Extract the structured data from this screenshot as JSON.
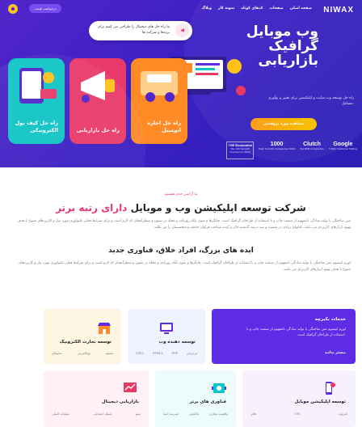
{
  "header": {
    "logo": "NIWAX",
    "nav": [
      "صفحه اصلی",
      "صفحات",
      "کدهای کوتاه",
      "نمونه کار",
      "وبلاگ"
    ],
    "request_button": "درخواست قیمت"
  },
  "hero": {
    "callout_text": "ما راه حل های دیجیتال را طراحی می کنیم برای برندها و شرکت ها",
    "title": "وب موبایل گرافیک بازاریابی",
    "subtitle": "راه حل توسعه وب سایت و اپلیکیشن برای تغییر و نوآوری مشاغل.",
    "cta": "مشاهده مورد پژوهشی",
    "cards": [
      {
        "label": "راه حل اجاره اتومبیل"
      },
      {
        "label": "راه حل بازاریابی"
      },
      {
        "label": "راه حل کیف پول الکترونیکی"
      }
    ],
    "badges": [
      {
        "big": "Google",
        "small": "5 Star Customer Rating"
      },
      {
        "big": "Clutch",
        "small": "Top B2B Companies"
      },
      {
        "big": "1000",
        "small": "High Growth Companies 2020"
      },
      {
        "big": "THE Economist",
        "small": "Top 100 Growth Champions 2020"
      }
    ],
    "colors": {
      "card_1": "#ff8a26",
      "card_2": "#e83a68",
      "card_3": "#0fc4c4"
    }
  },
  "intro": {
    "kicker": "ما آژانس جدی هستیم",
    "title_main": "شرکت توسعه اپلیکیشن وب و موبایل",
    "title_accent": "دارای رتبه برتر",
    "paragraph_1": "متن ساختگی با تولید سادگی نامفهوم از صنعت چاپ و با استفاده از طراحان گرافیک است. چاپگرها و متون بلکه روزنامه و مجله در ستون و سطرآنچنان که لازم است و برای شرایط فعلی تکنولوژی مورد نیاز و کاربردهای متنوع با هدف بهبود ابزارهای کاربردی می باشد. کتابهای زیادی در شصت و سه درصد گذشته حال و آینده شناخت فراوان جامعه و متخصصان را می طلبد.",
    "heading_2": "ایده های بزرگ، افراد خلاق، فناوری جدید",
    "paragraph_2": "لورم ایپسوم متن ساختگی با تولید سادگی نامفهوم از صنعت چاپ و با استفاده از طراحان گرافیک است. چاپگرها و متون بلکه روزنامه و مجله در ستون و سطرآنچنان که لازم است و برای شرایط فعلی تکنولوژی مورد نیاز و کاربردهای متنوع با هدف بهبود ابزارهای کاربردی می باشد."
  },
  "services": {
    "featured": {
      "title": "خدمات بکیرچه",
      "text": "لورم ایپسوم متن ساختگی با تولید سادگی نامفهوم از صنعت چاپ و با استفاده از طراحان گرافیک است.",
      "more": "بیشتر بدانید"
    },
    "items": [
      {
        "title": "توسعه دهنده وب",
        "tags": [
          "وردپرس",
          "PHP",
          "HTML5",
          "CSS3"
        ]
      },
      {
        "title": "توسعه تجارت الکترونیک",
        "tags": [
          "مجنتو",
          "ووکامرس",
          "شاپیفای"
        ]
      },
      {
        "title": "توسعه اپلیکیشن موبایل",
        "tags": [
          "اندروید",
          "iOS",
          "فلاتر"
        ]
      },
      {
        "title": "فناوری های برتر",
        "tags": [
          "واقعیت مجازی",
          "بلاکچین",
          "اینترنت اشیا"
        ]
      },
      {
        "title": "بازاریابی دیجیتال",
        "tags": [
          "سئو",
          "شبکه اجتماعی",
          "تبلیغات کلیکی"
        ]
      }
    ]
  }
}
